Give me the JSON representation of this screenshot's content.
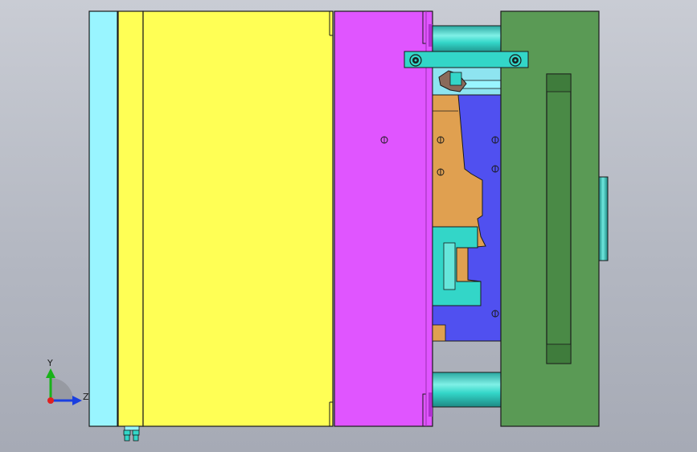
{
  "triad": {
    "y_label": "Y",
    "z_label": "Z",
    "y_color": "#19b219",
    "z_color": "#1a3fe0",
    "origin_color": "#e02020"
  },
  "colors": {
    "background": "#b6bac4",
    "cyan_plate": "#99f5ff",
    "yellow_plate": "#ffff55",
    "magenta_plate": "#e055ff",
    "green_plate": "#5a9a55",
    "core_blue": "#5050f0",
    "cavity_orange": "#e0a050",
    "teal_part": "#33d6c8",
    "outline": "#1a1a1a"
  }
}
